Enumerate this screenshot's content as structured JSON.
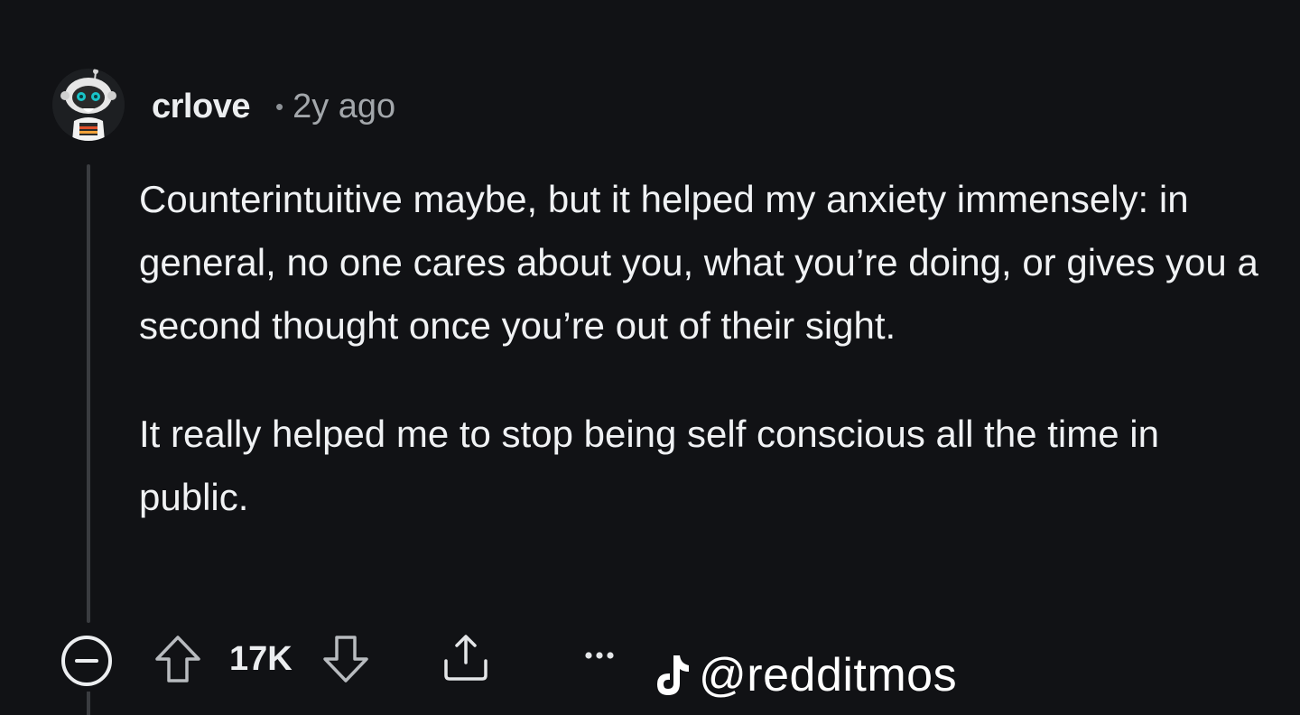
{
  "comment": {
    "username": "crlove",
    "separator": "•",
    "timestamp": "2y ago",
    "paragraphs": [
      "Counterintuitive maybe, but it helped my anxiety immensely: in general, no one cares about you, what you’re doing, or gives you a second thought once you’re out of their sight.",
      "It really helped me to stop being self conscious all the time in public."
    ]
  },
  "actions": {
    "vote_count": "17K",
    "icons": [
      "collapse-icon",
      "upvote-icon",
      "downvote-icon",
      "share-icon",
      "more-icon"
    ]
  },
  "watermark": {
    "icon": "tiktok-icon",
    "handle": "@redditmos"
  },
  "colors": {
    "background": "#111215",
    "text": "#f0f2f4",
    "muted": "#a3a7ab",
    "thread_line": "#3a3c40"
  }
}
